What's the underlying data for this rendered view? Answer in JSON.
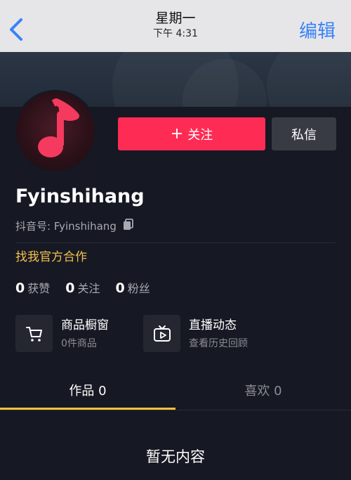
{
  "nav": {
    "day": "星期一",
    "time": "下午 4:31",
    "edit": "编辑"
  },
  "profile": {
    "follow_button": "关注",
    "follow_plus": "+",
    "message_button": "私信",
    "username": "Fyinshihang",
    "douyin_id": "抖音号: Fyinshihang",
    "cooperate": "找我官方合作"
  },
  "stats": [
    {
      "num": "0",
      "label": "获赞"
    },
    {
      "num": "0",
      "label": "关注"
    },
    {
      "num": "0",
      "label": "粉丝"
    }
  ],
  "services": [
    {
      "title": "商品橱窗",
      "subtitle": "0件商品",
      "icon": "cart-icon"
    },
    {
      "title": "直播动态",
      "subtitle": "查看历史回顾",
      "icon": "tv-play-icon"
    }
  ],
  "tabs": [
    {
      "label": "作品 0",
      "active": true
    },
    {
      "label": "喜欢 0",
      "active": false
    }
  ],
  "empty_text": "暂无内容",
  "colors": {
    "follow": "#fe2c55",
    "accent": "#f2c14e",
    "link": "#3a82f7",
    "bg": "#161823"
  }
}
